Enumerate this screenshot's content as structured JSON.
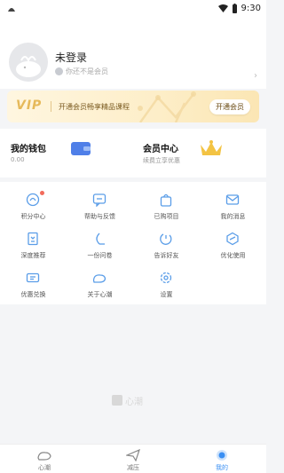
{
  "status_bar": {
    "time": "9:30"
  },
  "profile": {
    "name": "未登录",
    "subtitle": "你还不是会员"
  },
  "vip_banner": {
    "logo": "VIP",
    "text": "开通会员畅享精品课程",
    "button": "开通会员"
  },
  "wallet": {
    "title": "我的钱包",
    "value": "0.00"
  },
  "member": {
    "title": "会员中心",
    "subtitle": "续费立享优惠"
  },
  "grid": {
    "items": [
      {
        "label": "积分中心",
        "icon": "points-icon",
        "badge": true
      },
      {
        "label": "帮助与反馈",
        "icon": "feedback-icon"
      },
      {
        "label": "已购项目",
        "icon": "shopping-bag-icon"
      },
      {
        "label": "我的消息",
        "icon": "mail-icon"
      },
      {
        "label": "深度推荐",
        "icon": "bookmark-icon"
      },
      {
        "label": "一份问卷",
        "icon": "survey-icon"
      },
      {
        "label": "告诉好友",
        "icon": "share-icon"
      },
      {
        "label": "优化使用",
        "icon": "optimize-icon"
      },
      {
        "label": "优惠兑换",
        "icon": "coupon-icon"
      },
      {
        "label": "关于心潮",
        "icon": "about-icon"
      },
      {
        "label": "设置",
        "icon": "settings-icon"
      }
    ]
  },
  "watermark": {
    "text": "心潮"
  },
  "tabbar": {
    "tabs": [
      {
        "label": "心潮"
      },
      {
        "label": "减压"
      },
      {
        "label": "我的"
      }
    ]
  },
  "colors": {
    "accent": "#3a8ff3",
    "vip_gold": "#e6b95a",
    "icon_blue": "#5a9de8",
    "badge_red": "#f26b5b"
  }
}
